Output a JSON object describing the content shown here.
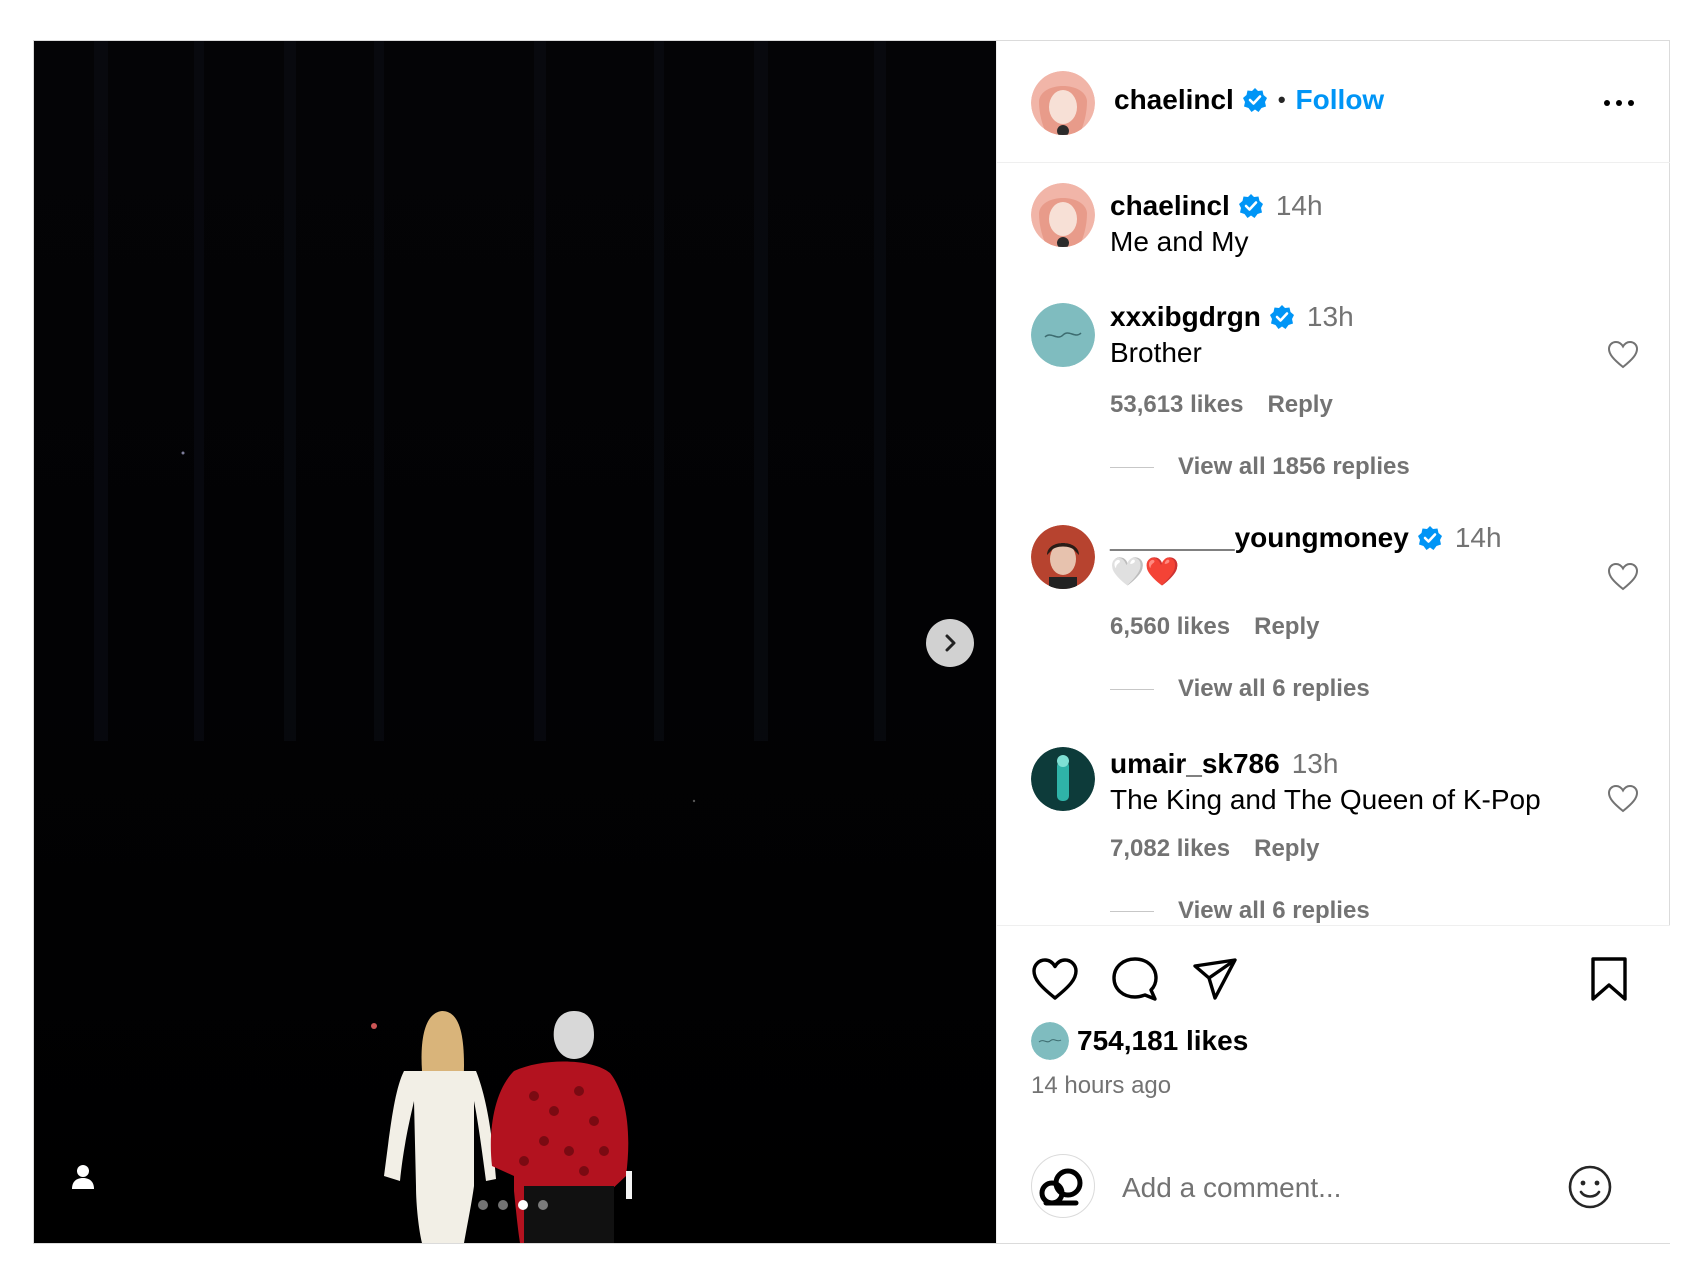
{
  "post": {
    "author": "chaelincl",
    "header_separator": "•",
    "follow_label": "Follow",
    "carousel": {
      "slide_count": 4,
      "active_index": 2
    }
  },
  "comments": [
    {
      "user": "chaelincl",
      "verified": true,
      "time": "14h",
      "text": "Me and My",
      "is_caption": true
    },
    {
      "user": "xxxibgdrgn",
      "verified": true,
      "time": "13h",
      "text": "Brother",
      "likes": "53,613 likes",
      "reply": "Reply",
      "view_replies": "View all 1856 replies"
    },
    {
      "user": "________youngmoney",
      "verified": true,
      "time": "14h",
      "text": "🤍❤️",
      "likes": "6,560 likes",
      "reply": "Reply",
      "view_replies": "View all 6 replies"
    },
    {
      "user": "umair_sk786",
      "verified": false,
      "time": "13h",
      "text": "The King and The Queen of K-Pop",
      "likes": "7,082 likes",
      "reply": "Reply",
      "view_replies": "View all 6 replies"
    }
  ],
  "footer": {
    "likes": "754,181 likes",
    "time_ago": "14 hours ago",
    "comment_placeholder": "Add a comment..."
  },
  "colors": {
    "accent": "#0095f6",
    "verified": "#0095f6",
    "muted": "#737373"
  }
}
